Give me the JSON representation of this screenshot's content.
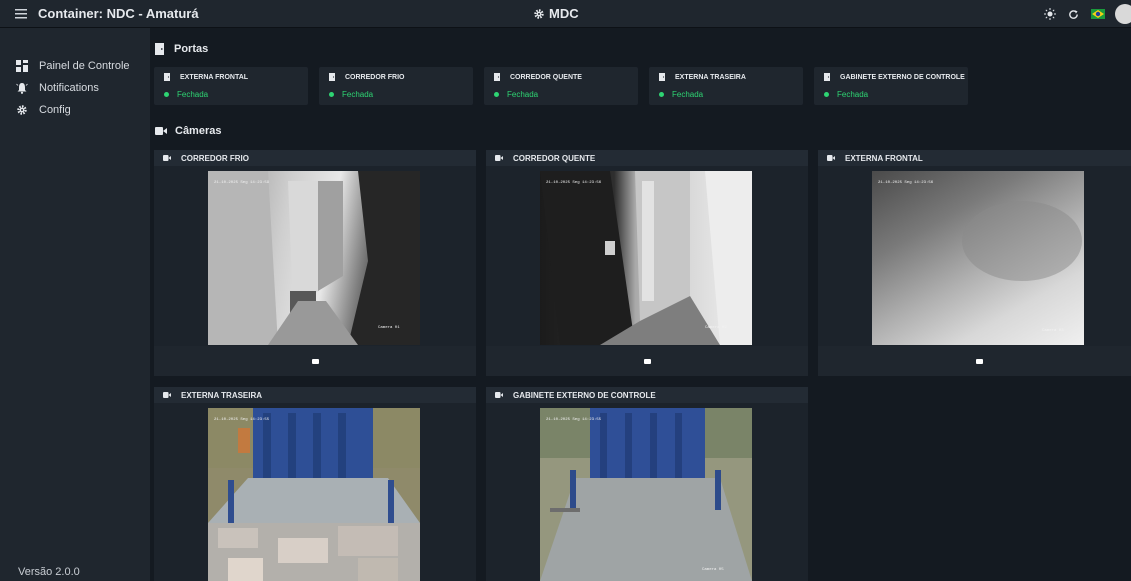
{
  "header": {
    "title": "Container: NDC - Amaturá",
    "center_title": "MDC",
    "icons": [
      "menu-icon",
      "gear-icon",
      "sun-icon",
      "refresh-icon",
      "brazil-flag-icon",
      "avatar"
    ]
  },
  "sidebar": {
    "items": [
      {
        "label": "Painel de Controle",
        "icon": "dashboard-icon"
      },
      {
        "label": "Notifications",
        "icon": "bell-icon"
      },
      {
        "label": "Config",
        "icon": "gear-icon"
      }
    ],
    "version": "Versão 2.0.0"
  },
  "doors": {
    "heading": "Portas",
    "items": [
      {
        "name": "EXTERNA FRONTAL",
        "status": "Fechada"
      },
      {
        "name": "CORREDOR FRIO",
        "status": "Fechada"
      },
      {
        "name": "CORREDOR QUENTE",
        "status": "Fechada"
      },
      {
        "name": "EXTERNA TRASEIRA",
        "status": "Fechada"
      },
      {
        "name": "GABINETE EXTERNO DE CONTROLE",
        "status": "Fechada"
      }
    ]
  },
  "cameras": {
    "heading": "Câmeras",
    "items": [
      {
        "name": "CORREDOR FRIO",
        "timestamp": "21-10-2025 Seg 14:23:59",
        "label": "Camera 01"
      },
      {
        "name": "CORREDOR QUENTE",
        "timestamp": "21-10-2025 Seg 14:23:56",
        "label": "Camera 02"
      },
      {
        "name": "EXTERNA FRONTAL",
        "timestamp": "21-10-2025 Seg 14:23:56",
        "label": "Camera 03"
      },
      {
        "name": "EXTERNA TRASEIRA",
        "timestamp": "21-10-2025 Seg 14:23:55",
        "label": ""
      },
      {
        "name": "GABINETE EXTERNO DE CONTROLE",
        "timestamp": "21-10-2025 Seg 14:23:55",
        "label": "Camera 05"
      }
    ]
  },
  "colors": {
    "status_green": "#2ed573",
    "background": "#141a21",
    "panel": "#1f262e"
  }
}
